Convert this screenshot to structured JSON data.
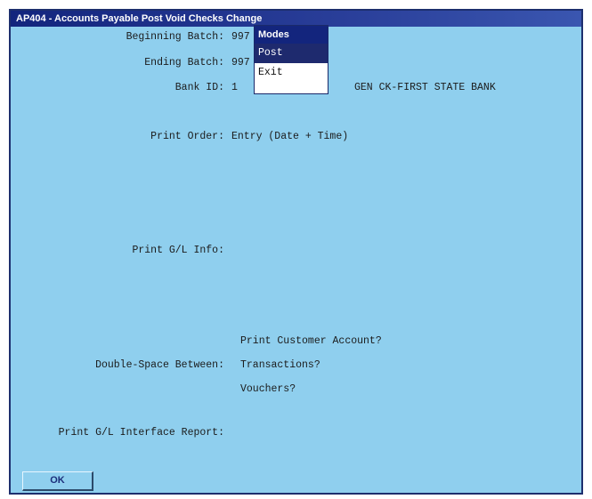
{
  "window": {
    "title": "AP404 - Accounts Payable Post Void Checks Change"
  },
  "fields": {
    "beginning_batch": {
      "label": "Beginning Batch:",
      "value": "997"
    },
    "ending_batch": {
      "label": "Ending Batch:",
      "value": "997"
    },
    "bank_id": {
      "label": "Bank ID:",
      "value": "1",
      "description": "GEN CK-FIRST STATE BANK"
    },
    "print_order": {
      "label": "Print Order:",
      "value": "Entry (Date + Time)"
    },
    "print_gl_info": {
      "label": "Print G/L Info:"
    },
    "double_space": {
      "label": "Double-Space Between:",
      "options": [
        "Print Customer Account?",
        "Transactions?",
        "Vouchers?"
      ]
    },
    "print_gl_interface": {
      "label": "Print G/L Interface Report:"
    }
  },
  "menu": {
    "header": "Modes",
    "items": [
      "Post",
      "Exit"
    ],
    "selected": "Post"
  },
  "buttons": {
    "ok_label": "OK"
  },
  "colors": {
    "background": "#8fcfee",
    "titlebar": "#13257d",
    "menu_selected": "#1e2a6e"
  }
}
